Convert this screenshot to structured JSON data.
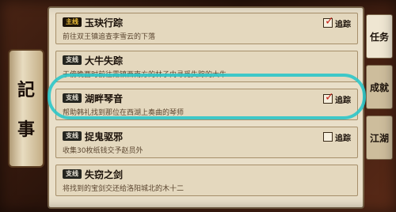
{
  "sidebar": {
    "chars": [
      "記",
      "事"
    ]
  },
  "quests": [
    {
      "badge": "主线",
      "title": "玉玦行踪",
      "desc": "前往双王镇追查李雪云的下落",
      "tracked": true,
      "track_label": "追踪"
    },
    {
      "badge": "支线",
      "title": "大牛失踪",
      "desc": "于傍晚酉时前往霞镇西南方的林子内寻觅失踪的大牛",
      "tracked": false,
      "track_label": ""
    },
    {
      "badge": "支线",
      "title": "湖畔琴音",
      "desc": "帮助韩礼找到那位在西湖上奏曲的琴师",
      "tracked": true,
      "track_label": "追踪"
    },
    {
      "badge": "支线",
      "title": "捉鬼驱邪",
      "desc": "收集30枚纸钱交予赵员外",
      "tracked": false,
      "track_label": "追踪"
    },
    {
      "badge": "支线",
      "title": "失窃之剑",
      "desc": "将找到的宝剑交还给洛阳城北的木十二",
      "tracked": false,
      "track_label": ""
    }
  ],
  "tabs": [
    {
      "label": "任务",
      "active": true
    },
    {
      "label": "成就",
      "active": false
    },
    {
      "label": "江湖",
      "active": false
    }
  ],
  "colors": {
    "highlight": "#2bc7c9",
    "check": "#c8251b",
    "main_badge_text": "#f1c23a"
  }
}
